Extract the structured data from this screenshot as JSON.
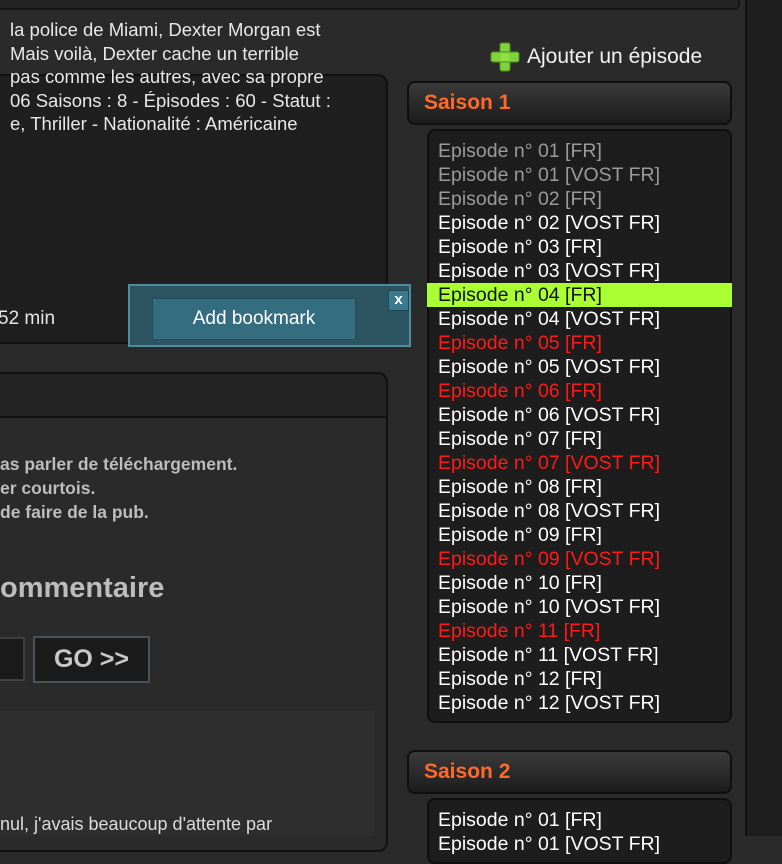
{
  "header": {
    "add_episode_label": "Ajouter un épisode"
  },
  "description": {
    "lines": [
      "la police de Miami, Dexter Morgan est",
      "Mais voilà, Dexter cache un terrible",
      " pas comme les autres, avec sa propre",
      "06 Saisons : 8 - Épisodes : 60 - Statut :",
      "e, Thriller - Nationalité : Américaine"
    ],
    "duration": "52 min"
  },
  "bookmark_popup": {
    "button_label": "Add bookmark",
    "close_label": "x"
  },
  "comments": {
    "rules": [
      "as parler de téléchargement.",
      "er courtois.",
      "de faire de la pub."
    ],
    "title": "ommentaire",
    "go_label": "GO >>",
    "first_comment": "nul, j'avais beaucoup d'attente par"
  },
  "seasons": [
    {
      "title": "Saison 1",
      "episodes": [
        {
          "label": "Episode n° 01 [FR]",
          "state": "seen"
        },
        {
          "label": "Episode n° 01 [VOST FR]",
          "state": "seen"
        },
        {
          "label": "Episode n° 02 [FR]",
          "state": "seen"
        },
        {
          "label": "Episode n° 02 [VOST FR]",
          "state": "normal"
        },
        {
          "label": "Episode n° 03 [FR]",
          "state": "normal"
        },
        {
          "label": "Episode n° 03 [VOST FR]",
          "state": "normal"
        },
        {
          "label": "Episode n° 04 [FR]",
          "state": "current"
        },
        {
          "label": "Episode n° 04 [VOST FR]",
          "state": "normal"
        },
        {
          "label": "Episode n° 05 [FR]",
          "state": "red"
        },
        {
          "label": "Episode n° 05 [VOST FR]",
          "state": "normal"
        },
        {
          "label": "Episode n° 06 [FR]",
          "state": "red"
        },
        {
          "label": "Episode n° 06 [VOST FR]",
          "state": "normal"
        },
        {
          "label": "Episode n° 07 [FR]",
          "state": "normal"
        },
        {
          "label": "Episode n° 07 [VOST FR]",
          "state": "red"
        },
        {
          "label": "Episode n° 08 [FR]",
          "state": "normal"
        },
        {
          "label": "Episode n° 08 [VOST FR]",
          "state": "normal"
        },
        {
          "label": "Episode n° 09 [FR]",
          "state": "normal"
        },
        {
          "label": "Episode n° 09 [VOST FR]",
          "state": "red"
        },
        {
          "label": "Episode n° 10 [FR]",
          "state": "normal"
        },
        {
          "label": "Episode n° 10 [VOST FR]",
          "state": "normal"
        },
        {
          "label": "Episode n° 11 [FR]",
          "state": "red"
        },
        {
          "label": "Episode n° 11 [VOST FR]",
          "state": "normal"
        },
        {
          "label": "Episode n° 12 [FR]",
          "state": "normal"
        },
        {
          "label": "Episode n° 12 [VOST FR]",
          "state": "normal"
        }
      ]
    },
    {
      "title": "Saison 2",
      "episodes": [
        {
          "label": "Episode n° 01 [FR]",
          "state": "normal"
        },
        {
          "label": "Episode n° 01 [VOST FR]",
          "state": "normal"
        }
      ]
    }
  ],
  "colors": {
    "season_title": "#ff6a2a",
    "episode_normal": "#ffffff",
    "episode_seen": "#9a9a9a",
    "episode_red": "#ff1a1a",
    "episode_current_bg": "#aaff33",
    "plus_icon": "#7ed43a"
  }
}
